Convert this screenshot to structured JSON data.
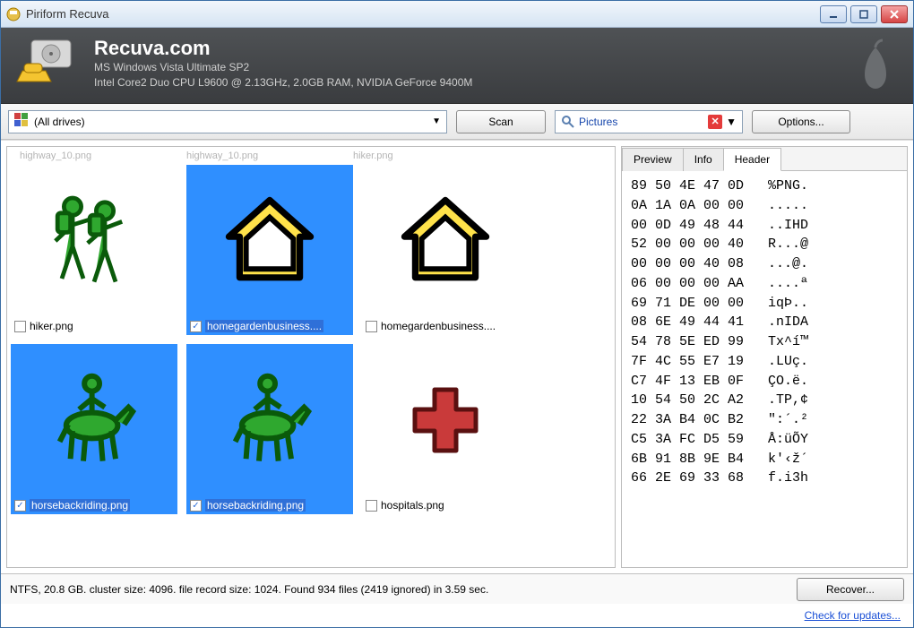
{
  "titlebar": {
    "text": "Piriform Recuva"
  },
  "banner": {
    "title": "Recuva.com",
    "line1": "MS Windows Vista Ultimate SP2",
    "line2": "Intel Core2 Duo CPU L9600 @ 2.13GHz, 2.0GB RAM, NVIDIA GeForce 9400M"
  },
  "toolbar": {
    "drives_text": "(All drives)",
    "scan_label": "Scan",
    "filter_text": "Pictures",
    "options_label": "Options..."
  },
  "top_fragments": {
    "a": "highway_10.png",
    "b": "highway_10.png",
    "c": "hiker.png"
  },
  "files": [
    {
      "label": "hiker.png",
      "selected": false,
      "checked": false,
      "icon": "hiker"
    },
    {
      "label": "homegardenbusiness....",
      "selected": true,
      "checked": true,
      "icon": "house-yellow"
    },
    {
      "label": "homegardenbusiness....",
      "selected": false,
      "checked": false,
      "icon": "house-yellow"
    },
    {
      "label": "horsebackriding.png",
      "selected": true,
      "checked": true,
      "icon": "horse"
    },
    {
      "label": "horsebackriding.png",
      "selected": true,
      "checked": true,
      "icon": "horse"
    },
    {
      "label": "hospitals.png",
      "selected": false,
      "checked": false,
      "icon": "cross-red"
    }
  ],
  "tabs": {
    "t1": "Preview",
    "t2": "Info",
    "t3": "Header"
  },
  "hex": "89 50 4E 47 0D   %PNG.\n0A 1A 0A 00 00   .....\n00 0D 49 48 44   ..IHD\n52 00 00 00 40   R...@\n00 00 00 40 08   ...@.\n06 00 00 00 AA   ....ª\n69 71 DE 00 00   iqÞ..\n08 6E 49 44 41   .nIDA\n54 78 5E ED 99   Tx^í™\n7F 4C 55 E7 19   .LUç.\nC7 4F 13 EB 0F   ÇO.ë.\n10 54 50 2C A2   .TP,¢\n22 3A B4 0C B2   \":´.²\nC5 3A FC D5 59   Å:üÕY\n6B 91 8B 9E B4   k'‹ž´\n66 2E 69 33 68   f.i3h",
  "status": {
    "text": "NTFS, 20.8 GB. cluster size: 4096. file record size: 1024. Found 934 files (2419 ignored) in 3.59 sec.",
    "recover_label": "Recover..."
  },
  "link": {
    "text": "Check for updates..."
  }
}
